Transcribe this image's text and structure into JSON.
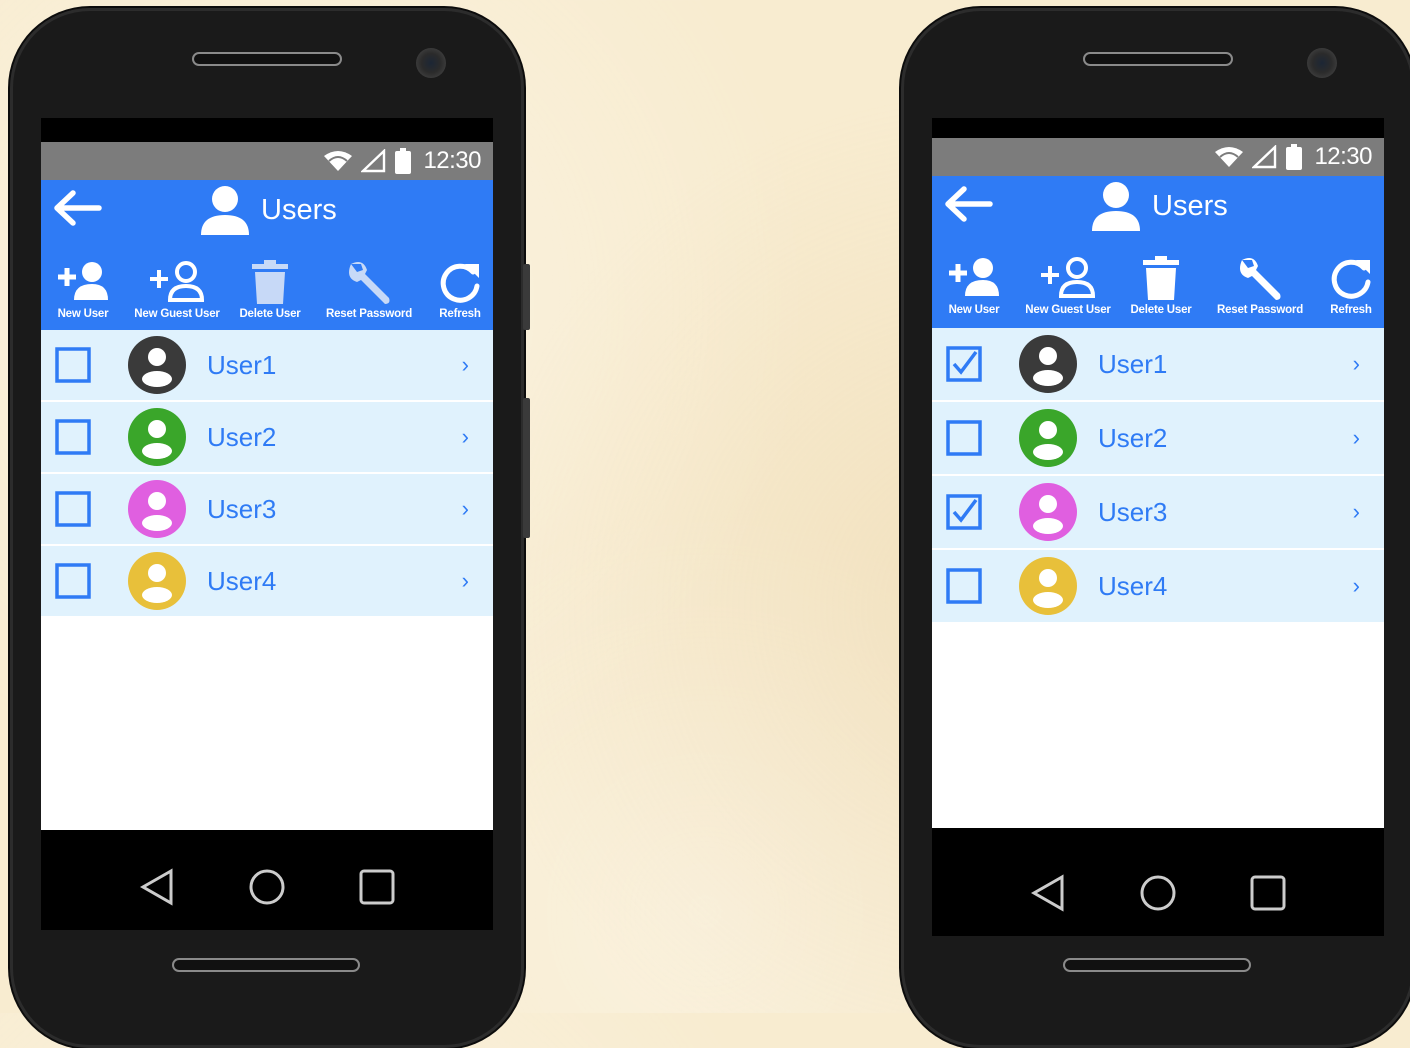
{
  "phones": [
    {
      "statusbar": {
        "time": "12:30"
      },
      "header": {
        "title": "Users"
      },
      "actions": [
        {
          "label": "New User",
          "icon": "add-user-icon"
        },
        {
          "label": "New Guest User",
          "icon": "add-guest-user-icon"
        },
        {
          "label": "Delete User",
          "icon": "trash-icon",
          "disabled": true
        },
        {
          "label": "Reset Password",
          "icon": "wrench-icon",
          "disabled": true
        },
        {
          "label": "Refresh",
          "icon": "refresh-icon"
        }
      ],
      "users": [
        {
          "name": "User1",
          "color": "#3a3a3a",
          "checked": false
        },
        {
          "name": "User2",
          "color": "#3aa62a",
          "checked": false
        },
        {
          "name": "User3",
          "color": "#e05fe0",
          "checked": false
        },
        {
          "name": "User4",
          "color": "#e8c03a",
          "checked": false
        }
      ]
    },
    {
      "statusbar": {
        "time": "12:30"
      },
      "header": {
        "title": "Users"
      },
      "actions": [
        {
          "label": "New User",
          "icon": "add-user-icon"
        },
        {
          "label": "New Guest User",
          "icon": "add-guest-user-icon"
        },
        {
          "label": "Delete User",
          "icon": "trash-icon",
          "disabled": false
        },
        {
          "label": "Reset Password",
          "icon": "wrench-icon",
          "disabled": false
        },
        {
          "label": "Refresh",
          "icon": "refresh-icon"
        }
      ],
      "users": [
        {
          "name": "User1",
          "color": "#3a3a3a",
          "checked": true
        },
        {
          "name": "User2",
          "color": "#3aa62a",
          "checked": false
        },
        {
          "name": "User3",
          "color": "#e05fe0",
          "checked": true
        },
        {
          "name": "User4",
          "color": "#e8c03a",
          "checked": false
        }
      ]
    }
  ],
  "colors": {
    "primary": "#2f7bf5",
    "row_bg": "#e0f2fd",
    "statusbar": "#7c7c7c",
    "disabled_icon": "#c7d9f7"
  }
}
